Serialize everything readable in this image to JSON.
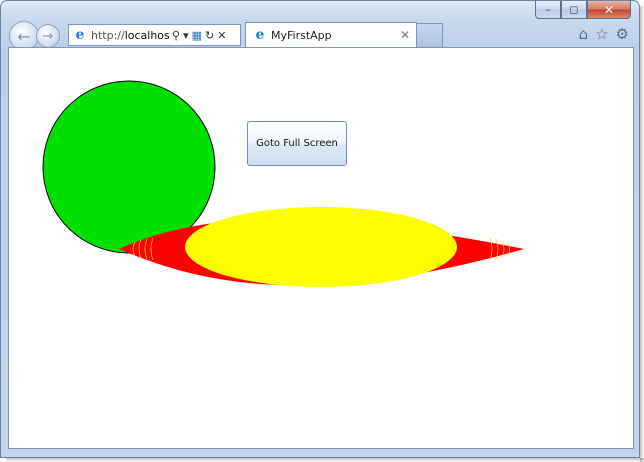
{
  "window": {
    "minimize_icon": "minimize-icon",
    "maximize_icon": "maximize-icon",
    "close_icon": "close-icon"
  },
  "nav": {
    "back_icon": "back-arrow-icon",
    "forward_icon": "forward-arrow-icon"
  },
  "address": {
    "prefix": "http://",
    "host": "localhost:"
  },
  "tab": {
    "title": "MyFirstApp"
  },
  "toolbar": {
    "icons": [
      "home-icon",
      "favorites-star-icon",
      "settings-gear-icon"
    ]
  },
  "app": {
    "button_label": "Goto Full Screen",
    "colors": {
      "circle": "#00e000",
      "outer_ellipse": "#ff0000",
      "inner_ellipse": "#ffff00"
    }
  }
}
